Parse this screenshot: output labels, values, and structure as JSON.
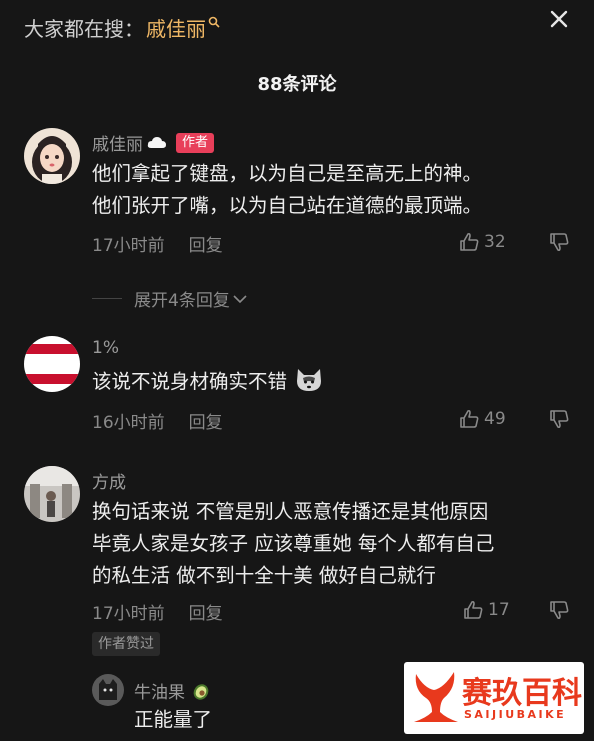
{
  "header": {
    "search_prefix": "大家都在搜：",
    "search_term": "戚佳丽",
    "comment_count": "88条评论"
  },
  "comments": [
    {
      "name": "戚佳丽",
      "badge": "作者",
      "lines": [
        "他们拿起了键盘，以为自己是至高无上的神。",
        "他们张开了嘴，以为自己站在道德的最顶端。"
      ],
      "time": "17小时前",
      "reply": "回复",
      "likes": "32",
      "expand": "展开4条回复"
    },
    {
      "name": "1%",
      "lines": [
        "该说不说身材确实不错"
      ],
      "time": "16小时前",
      "reply": "回复",
      "likes": "49"
    },
    {
      "name": "方成",
      "lines": [
        "换句话来说 不管是别人恶意传播还是其他原因",
        "毕竟人家是女孩子 应该尊重她 每个人都有自己",
        "的私生活 做不到十全十美 做好自己就行"
      ],
      "time": "17小时前",
      "reply": "回复",
      "likes": "17",
      "tag": "作者赞过"
    }
  ],
  "sub_reply": {
    "name": "牛油果",
    "text": "正能量了"
  },
  "watermark": {
    "title": "赛玖百科",
    "subtitle": "SAIJIUBAIKE"
  },
  "colors": {
    "background": "#161616",
    "search_term": "#f0b866",
    "author_badge": "#e83f5a",
    "watermark_red": "#e8391d"
  }
}
